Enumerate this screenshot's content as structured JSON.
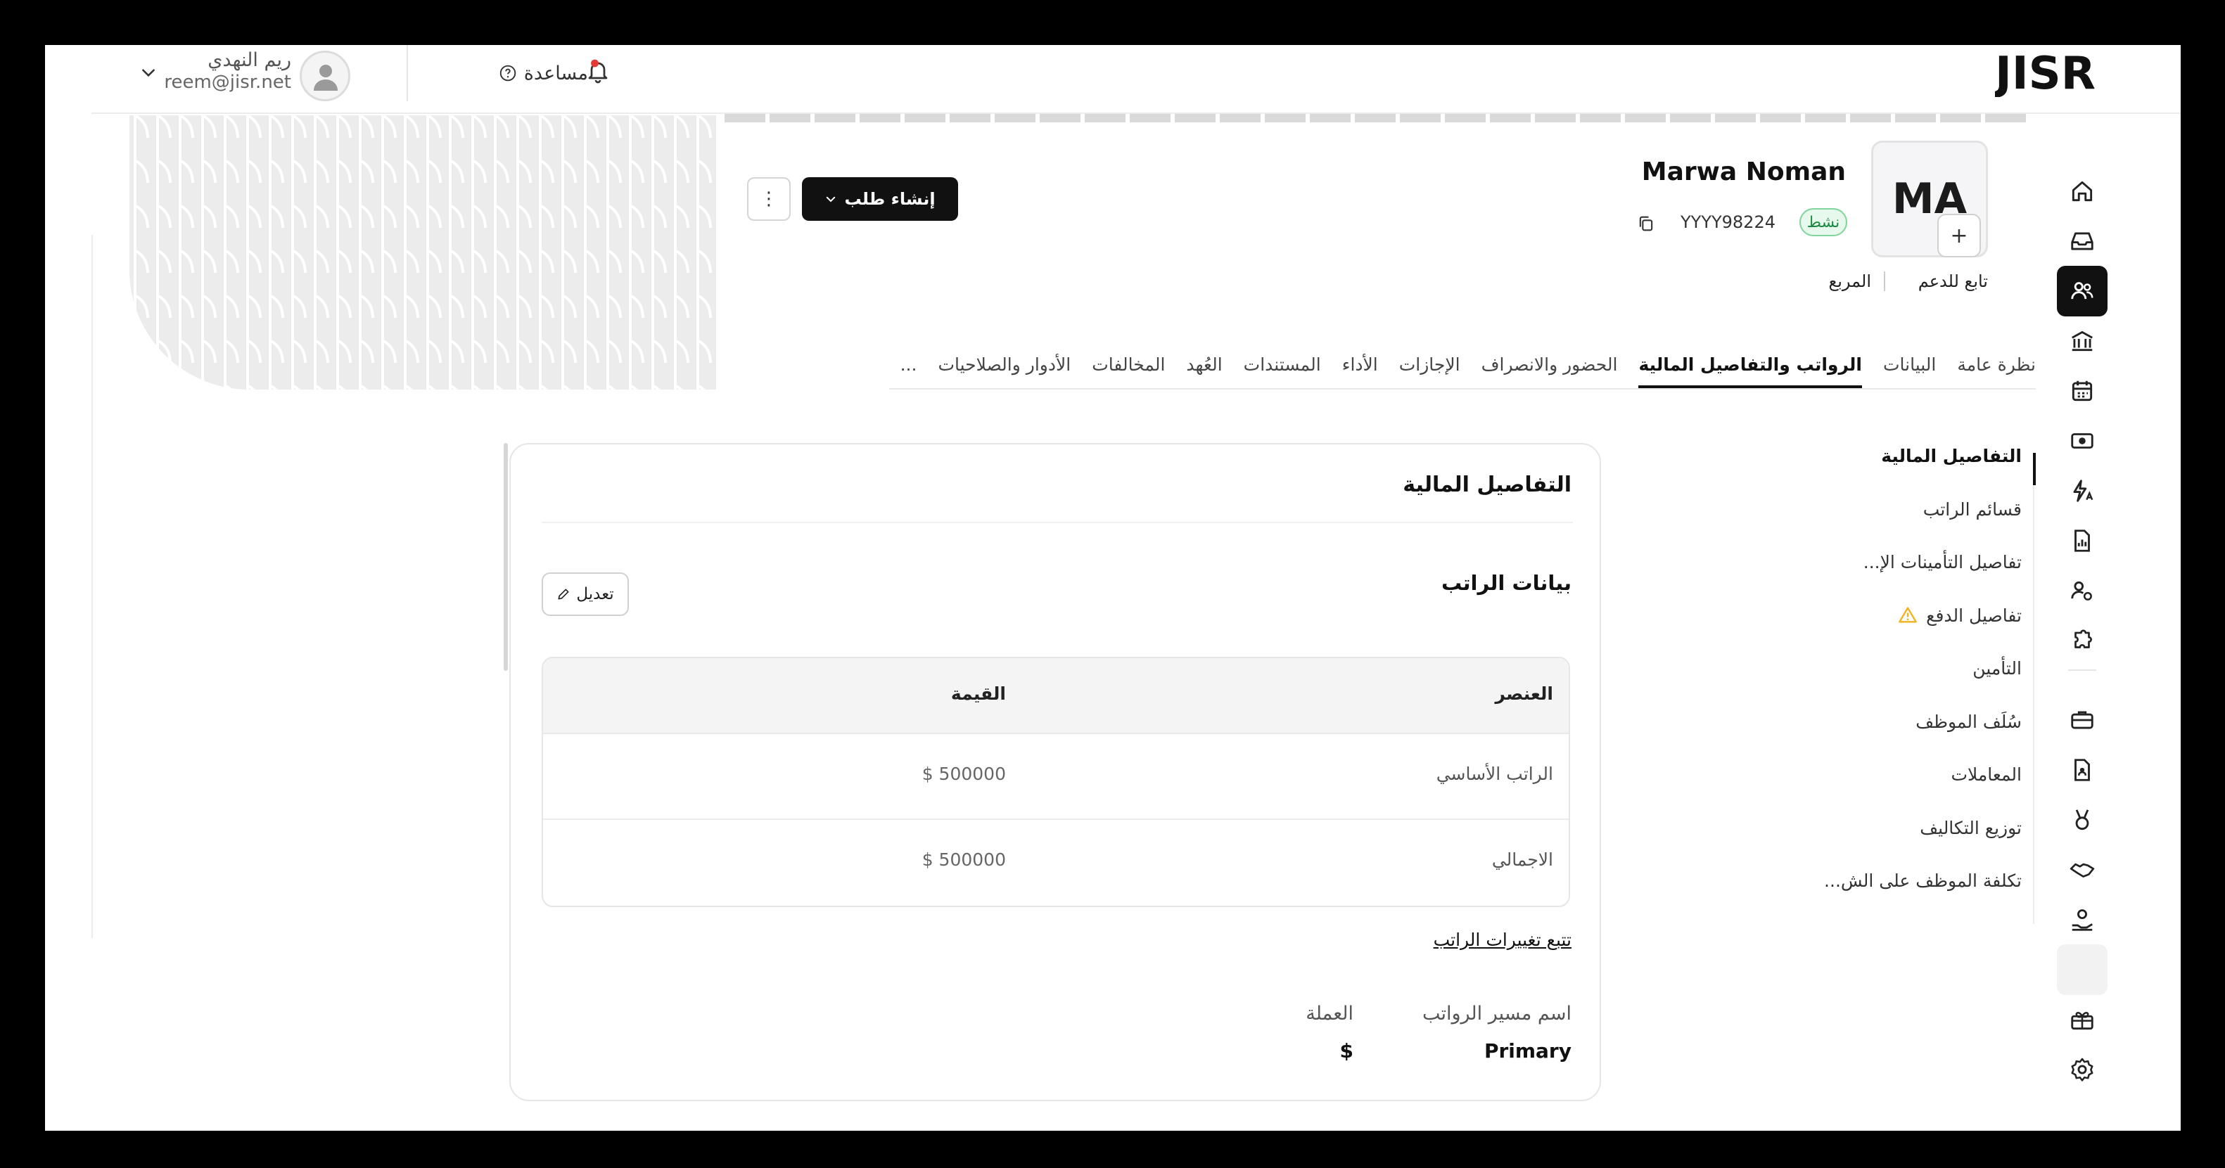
{
  "header": {
    "logo": "JISR",
    "user_name": "ريم النهدي",
    "user_email": "reem@jisr.net",
    "help_label": "مساعدة"
  },
  "profile": {
    "initials": "MA",
    "plus": "+",
    "name": "Marwa Noman",
    "status": "نشط",
    "employee_id": "YYYY98224",
    "department": "تابع للدعم",
    "location": "المربع",
    "create_request_label": "إنشاء طلب",
    "more_label": "⋮"
  },
  "tabs": [
    {
      "label": "نظرة عامة",
      "active": false
    },
    {
      "label": "البيانات",
      "active": false
    },
    {
      "label": "الرواتب والتفاصيل المالية",
      "active": true
    },
    {
      "label": "الحضور والانصراف",
      "active": false
    },
    {
      "label": "الإجازات",
      "active": false
    },
    {
      "label": "الأداء",
      "active": false
    },
    {
      "label": "المستندات",
      "active": false
    },
    {
      "label": "العُهد",
      "active": false
    },
    {
      "label": "المخالفات",
      "active": false
    },
    {
      "label": "الأدوار والصلاحيات",
      "active": false
    },
    {
      "label": "...",
      "active": false
    }
  ],
  "section_nav": [
    {
      "label": "التفاصيل المالية",
      "active": true,
      "warning": false
    },
    {
      "label": "قسائم الراتب",
      "active": false,
      "warning": false
    },
    {
      "label": "تفاصيل التأمينات الإ...",
      "active": false,
      "warning": false
    },
    {
      "label": "تفاصيل الدفع",
      "active": false,
      "warning": true
    },
    {
      "label": "التأمين",
      "active": false,
      "warning": false
    },
    {
      "label": "سُلَف الموظف",
      "active": false,
      "warning": false
    },
    {
      "label": "المعاملات",
      "active": false,
      "warning": false
    },
    {
      "label": "توزيع التكاليف",
      "active": false,
      "warning": false
    },
    {
      "label": "تكلفة الموظف على الش...",
      "active": false,
      "warning": false
    }
  ],
  "card": {
    "title": "التفاصيل المالية",
    "salary_title": "بيانات الراتب",
    "edit_label": "تعديل",
    "table": {
      "headers": {
        "item": "العنصر",
        "value": "القيمة"
      },
      "rows": [
        {
          "item": "الراتب الأساسي",
          "value": "$ 500000"
        },
        {
          "item": "الاجمالي",
          "value": "$ 500000"
        }
      ]
    },
    "track_link": "تتبع تغييرات الراتب",
    "runner_label": "اسم مسير الرواتب",
    "runner_value": "Primary",
    "currency_label": "العملة",
    "currency_value": "$"
  },
  "colors": {
    "accent": "#111111",
    "status_bg": "#e7f8ec",
    "status_text": "#1e8a44",
    "warning": "#f2b01e",
    "notification": "#e53935"
  }
}
